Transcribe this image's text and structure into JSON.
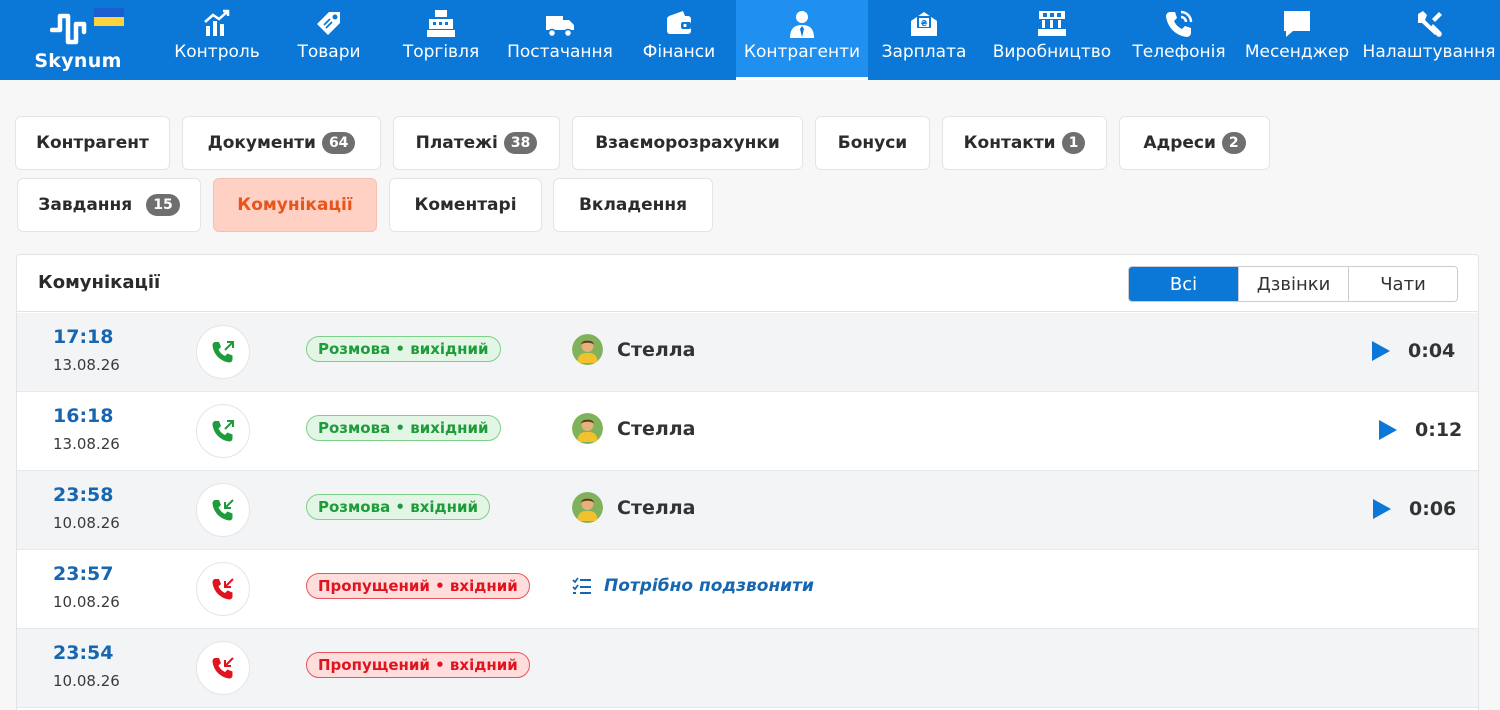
{
  "app": {
    "brand": "Skynum",
    "colors": {
      "nav_bg": "#0b78d8",
      "nav_active": "#1f8ff0",
      "tab_active_bg": "#ffd1c5",
      "tab_active_text": "#e8541c",
      "time_blue": "#1767b0",
      "ok_green": "#1e9c3b",
      "missed_red": "#e0141f"
    }
  },
  "nav": [
    {
      "label": "Контроль",
      "icon": "chart-growth-icon"
    },
    {
      "label": "Товари",
      "icon": "price-tag-icon"
    },
    {
      "label": "Торгівля",
      "icon": "cash-register-icon"
    },
    {
      "label": "Постачання",
      "icon": "delivery-truck-icon"
    },
    {
      "label": "Фінанси",
      "icon": "wallet-icon"
    },
    {
      "label": "Контрагенти",
      "icon": "person-tie-icon",
      "active": true
    },
    {
      "label": "Зарплата",
      "icon": "salary-envelope-icon"
    },
    {
      "label": "Виробництво",
      "icon": "factory-icon"
    },
    {
      "label": "Телефонія",
      "icon": "phone-ring-icon"
    },
    {
      "label": "Месенджер",
      "icon": "chat-bubble-icon"
    },
    {
      "label": "Налаштування",
      "icon": "tools-icon"
    }
  ],
  "tabs_row1": [
    {
      "label": "Контрагент"
    },
    {
      "label": "Документи",
      "badge": "64"
    },
    {
      "label": "Платежі",
      "badge": "38"
    },
    {
      "label": "Взаєморозрахунки"
    },
    {
      "label": "Бонуси"
    },
    {
      "label": "Контакти",
      "badge": "1"
    },
    {
      "label": "Адреси",
      "badge": "2"
    }
  ],
  "tabs_row2": [
    {
      "label": "Завдання",
      "badge": "15"
    },
    {
      "label": "Комунікації",
      "active": true
    },
    {
      "label": "Коментарі"
    },
    {
      "label": "Вкладення"
    }
  ],
  "panel": {
    "title": "Комунікації",
    "filters": [
      "Всі",
      "Дзвінки",
      "Чати"
    ],
    "active_filter": "Всі"
  },
  "rows": [
    {
      "time": "17:18",
      "date": "13.08.26",
      "direction": "outgoing",
      "state": "ok",
      "status": "Розмова • вихідний",
      "contact": "Стелла",
      "duration": "0:04"
    },
    {
      "time": "16:18",
      "date": "13.08.26",
      "direction": "outgoing",
      "state": "ok",
      "status": "Розмова • вихідний",
      "contact": "Стелла",
      "duration": "0:12"
    },
    {
      "time": "23:58",
      "date": "10.08.26",
      "direction": "incoming",
      "state": "ok",
      "status": "Розмова • вхідний",
      "contact": "Стелла",
      "duration": "0:06"
    },
    {
      "time": "23:57",
      "date": "10.08.26",
      "direction": "incoming",
      "state": "missed",
      "status": "Пропущений • вхідний",
      "task": "Потрібно подзвонити"
    },
    {
      "time": "23:54",
      "date": "10.08.26",
      "direction": "incoming",
      "state": "missed",
      "status": "Пропущений • вхідний"
    }
  ]
}
